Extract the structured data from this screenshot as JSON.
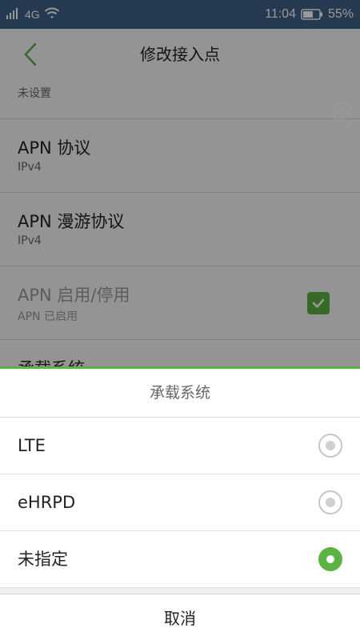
{
  "statusbar": {
    "network": "4G",
    "time": "11:04",
    "battery_percent": "55%",
    "icons": [
      "signal-icon",
      "wifi-icon",
      "battery-icon"
    ]
  },
  "header": {
    "title": "修改接入点",
    "back_icon": "chevron-left-icon"
  },
  "list": {
    "partial_sub": "未设置",
    "items": [
      {
        "title": "APN 协议",
        "value": "IPv4"
      },
      {
        "title": "APN 漫游协议",
        "value": "IPv4"
      },
      {
        "title": "APN 启用/停用",
        "value": "APN 已启用",
        "checked": true
      },
      {
        "title": "承载系统",
        "value": ""
      }
    ]
  },
  "sheet": {
    "title": "承载系统",
    "options": [
      {
        "label": "LTE",
        "selected": false
      },
      {
        "label": "eHRPD",
        "selected": false
      },
      {
        "label": "未指定",
        "selected": true
      }
    ],
    "cancel_label": "取消"
  },
  "colors": {
    "accent": "#5bb342",
    "statusbar": "#3e5f86"
  }
}
